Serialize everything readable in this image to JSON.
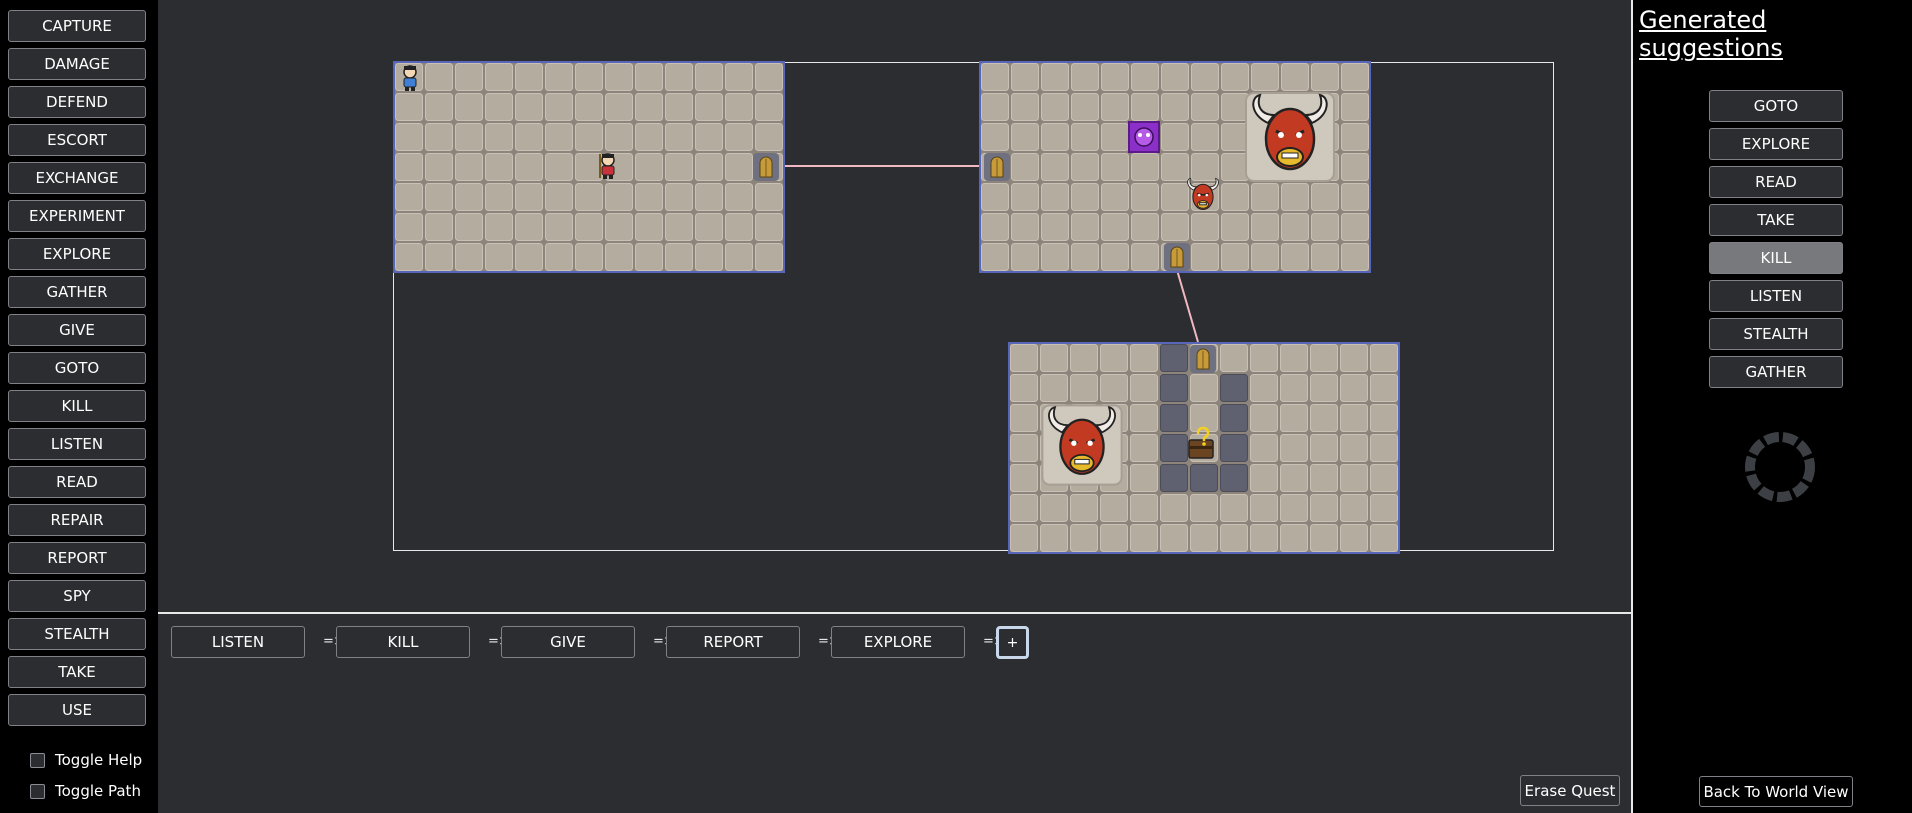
{
  "actions": [
    "CAPTURE",
    "DAMAGE",
    "DEFEND",
    "ESCORT",
    "EXCHANGE",
    "EXPERIMENT",
    "EXPLORE",
    "GATHER",
    "GIVE",
    "GOTO",
    "KILL",
    "LISTEN",
    "READ",
    "REPAIR",
    "REPORT",
    "SPY",
    "STEALTH",
    "TAKE",
    "USE"
  ],
  "toggles": {
    "help_label": "Toggle Help",
    "path_label": "Toggle Path"
  },
  "quest": {
    "steps": [
      "LISTEN",
      "KILL",
      "GIVE",
      "REPORT",
      "EXPLORE"
    ],
    "arrow": "=>",
    "add_label": "+",
    "erase_label": "Erase Quest"
  },
  "suggestions": {
    "title": "Generated suggestions",
    "items": [
      "GOTO",
      "EXPLORE",
      "READ",
      "TAKE",
      "KILL",
      "LISTEN",
      "STEALTH",
      "GATHER"
    ],
    "selected": "KILL",
    "back_label": "Back To World View"
  },
  "map": {
    "rooms": [
      {
        "name": "room-top-left",
        "entities": [
          "player-icon",
          "npc-villager-icon",
          "door-icon"
        ]
      },
      {
        "name": "room-top-right",
        "entities": [
          "door-icon",
          "purple-demon-tile-icon",
          "minotaur-boss-icon",
          "small-minotaur-icon",
          "door-icon"
        ]
      },
      {
        "name": "room-bottom-right",
        "entities": [
          "door-icon",
          "minotaur-boss-icon",
          "treasure-chest-icon"
        ]
      }
    ],
    "colors": {
      "floor": "#b5aca0",
      "grout": "#8d857b",
      "room_border": "#5766b8",
      "connector": "#f2b8c2",
      "wall_block": "#5f6170"
    }
  }
}
